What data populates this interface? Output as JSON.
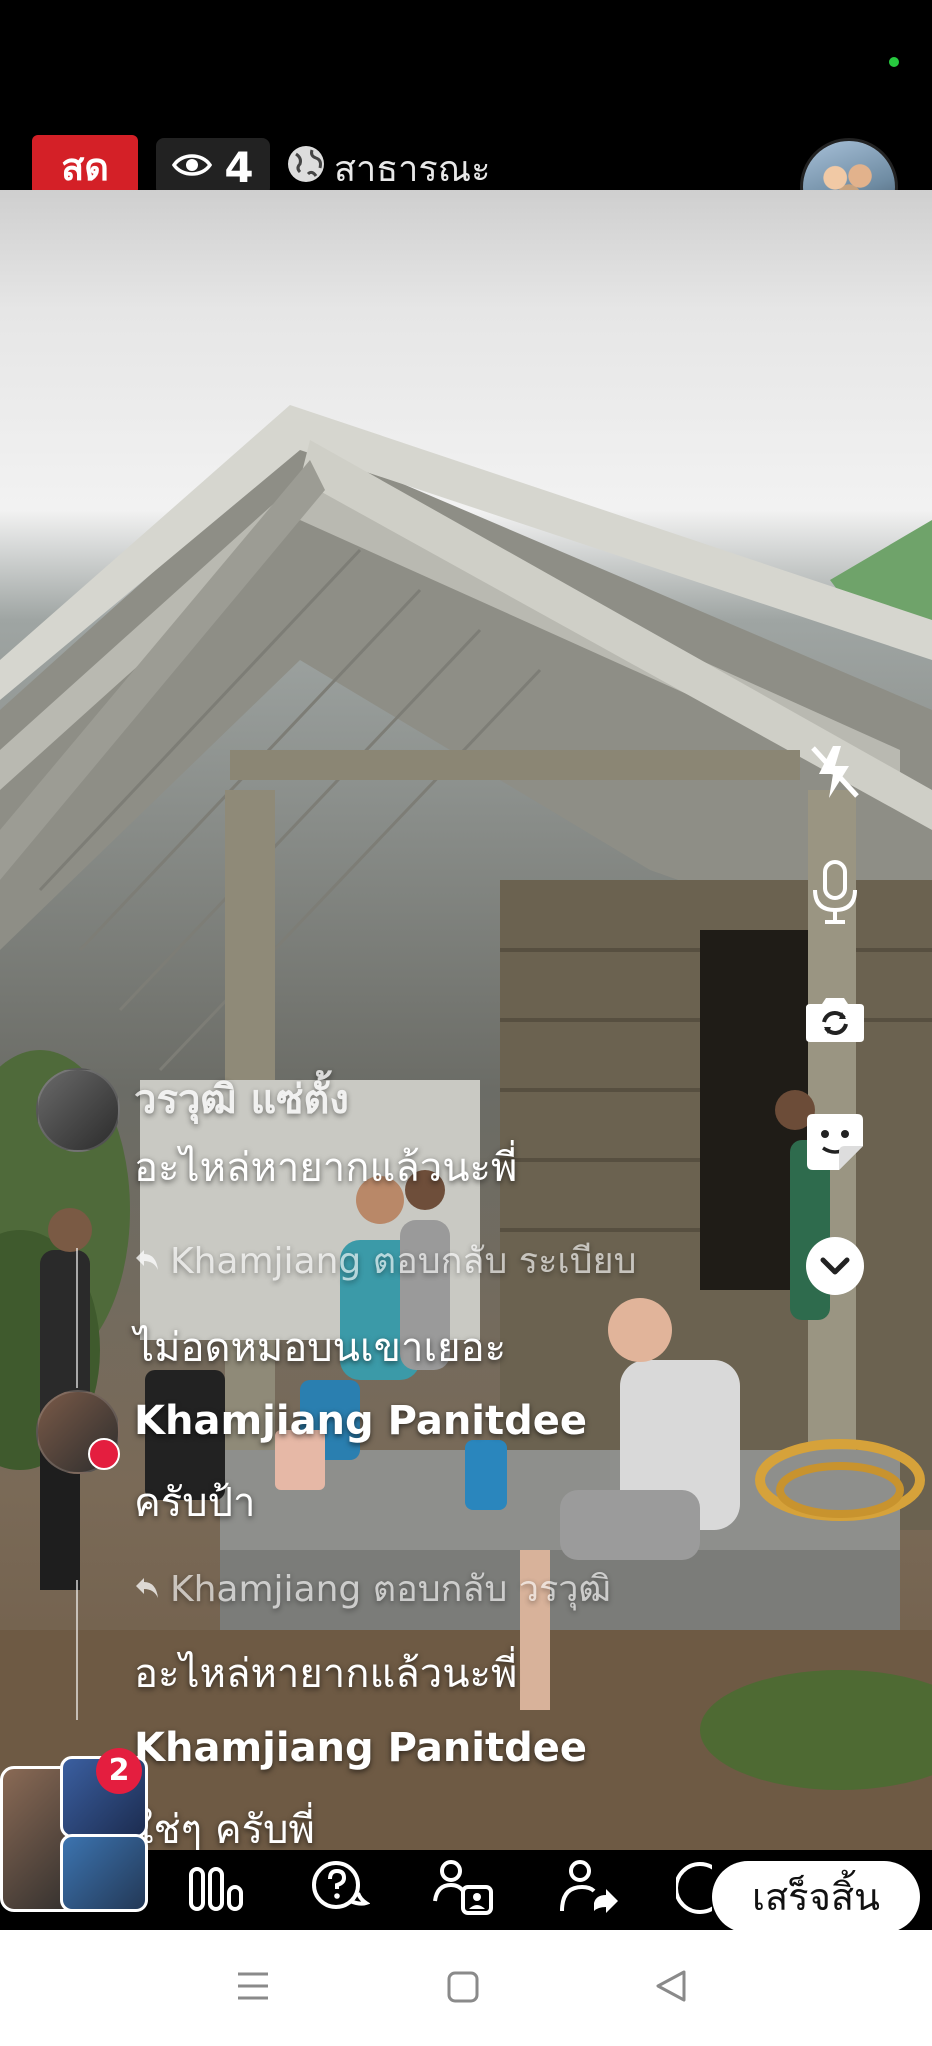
{
  "live": {
    "badge_label": "สด",
    "viewer_count": "4",
    "privacy_label": "สาธารณะ"
  },
  "comments": [
    {
      "name": "วรวุฒิ แซ่ตั้ง",
      "text": "อะไหล่หายากแล้วนะพี่"
    },
    {
      "reply_to": "Khamjiang ตอบกลับ ระเบียบ",
      "text": "ไม่อดหมอบนเขาเยอะ"
    },
    {
      "name": "Khamjiang Panitdee",
      "text": "ครับป้า"
    },
    {
      "reply_to": "Khamjiang ตอบกลับ วรวุฒิ",
      "text": "อะไหล่หายากแล้วนะพี่"
    },
    {
      "name": "Khamjiang Panitdee",
      "text": "ใช่ๆ ครับพี่"
    }
  ],
  "viewers_badge": "2",
  "toolbar": {
    "finish_label": "เสร็จสิ้น"
  },
  "controls": [
    "flash-off-icon",
    "microphone-icon",
    "flip-camera-icon",
    "sticker-icon",
    "chevron-down-icon"
  ],
  "colors": {
    "live_red": "#d42027",
    "notification_red": "#e41e3f",
    "active_green": "#2db742"
  }
}
